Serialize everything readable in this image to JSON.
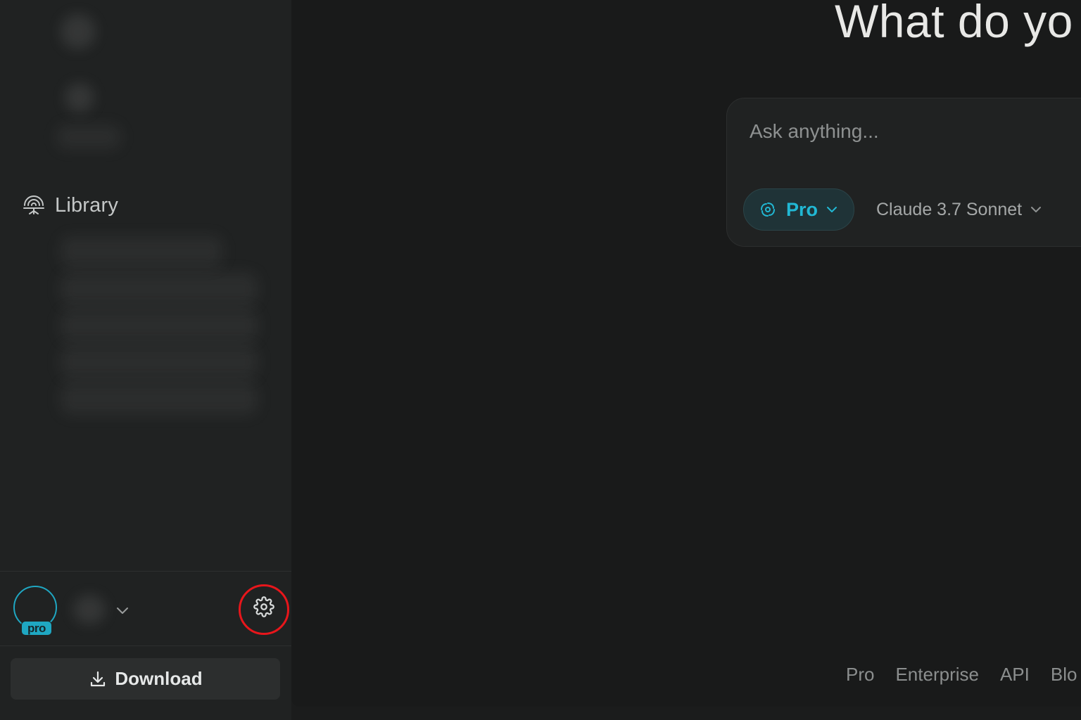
{
  "sidebar": {
    "library_label": "Library",
    "download_label": "Download",
    "pro_badge": "pro"
  },
  "main": {
    "headline": "What do yo",
    "search": {
      "placeholder": "Ask anything..."
    },
    "mode_label": "Pro",
    "model_label": "Claude 3.7 Sonnet"
  },
  "footer": {
    "links": [
      "Pro",
      "Enterprise",
      "API",
      "Blo"
    ]
  },
  "colors": {
    "accent": "#21b8d4",
    "highlight": "#e8161b",
    "sidebar_bg": "#202222",
    "main_bg": "#191a1a"
  },
  "icons": {
    "library": "library-icon",
    "download": "download-icon",
    "settings": "gear-icon",
    "mode": "pro-search-icon",
    "chevron": "chevron-down-icon"
  }
}
